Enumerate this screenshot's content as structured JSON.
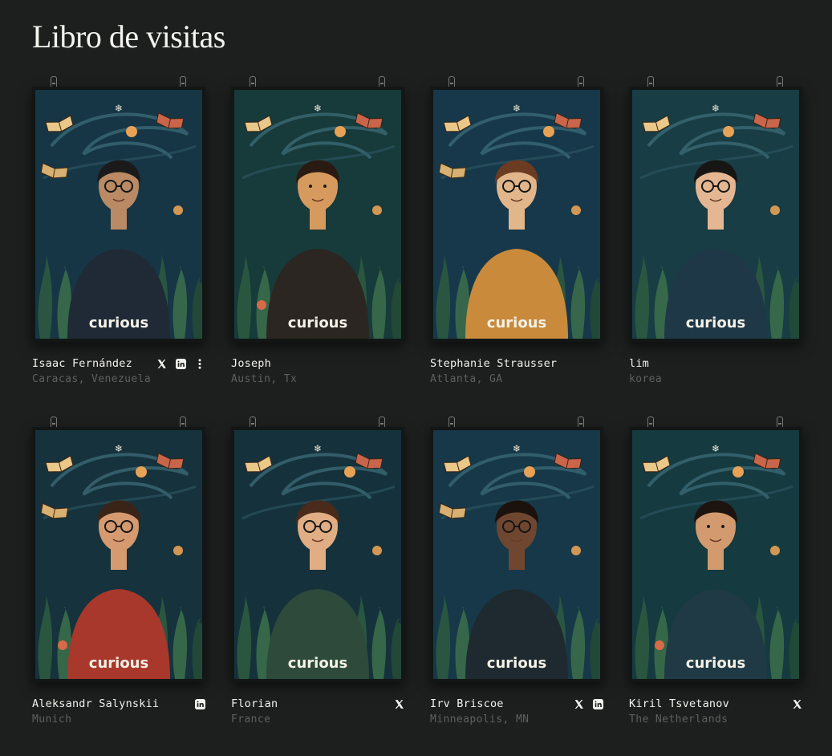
{
  "page": {
    "title": "Libro de visitas"
  },
  "poster_brand": "curious",
  "colors": {
    "background": "#1d1e1e",
    "poster_sky": "#1a3a44",
    "foliage": "#2c5a40",
    "accent_orange": "#e8a255"
  },
  "entries": [
    {
      "name": "Isaac Fernández",
      "location": "Caracas, Venezuela",
      "socials": [
        "x-icon",
        "linkedin-icon",
        "more-vertical-icon"
      ]
    },
    {
      "name": "Joseph",
      "location": "Austin, Tx",
      "socials": []
    },
    {
      "name": "Stephanie Strausser",
      "location": "Atlanta, GA",
      "socials": []
    },
    {
      "name": "lim",
      "location": "korea",
      "socials": []
    },
    {
      "name": "Aleksandr Salynskii",
      "location": "Munich",
      "socials": [
        "linkedin-icon"
      ]
    },
    {
      "name": "Florian",
      "location": "France",
      "socials": [
        "x-icon"
      ]
    },
    {
      "name": "Irv Briscoe",
      "location": "Minneapolis, MN",
      "socials": [
        "x-icon",
        "linkedin-icon"
      ]
    },
    {
      "name": "Kiril Tsvetanov",
      "location": "The Netherlands",
      "socials": [
        "x-icon"
      ]
    }
  ]
}
